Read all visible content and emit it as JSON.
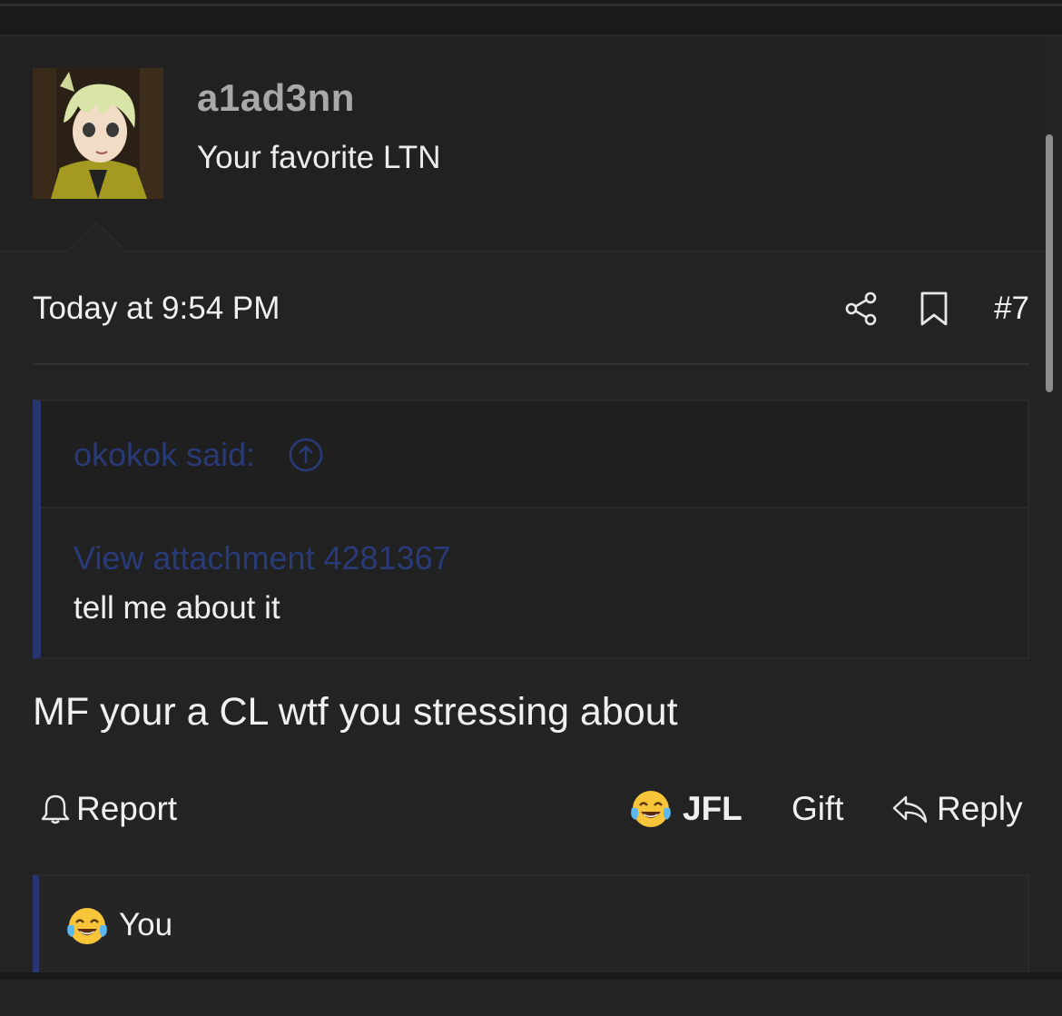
{
  "post": {
    "username": "a1ad3nn",
    "user_title": "Your favorite LTN",
    "timestamp": "Today at 9:54 PM",
    "post_number": "#7",
    "icons": {
      "share": "share-icon",
      "bookmark": "bookmark-icon",
      "quote_up": "arrow-up-circle-icon",
      "report": "bell-icon",
      "reply": "reply-arrow-icon",
      "reaction": "face-with-tears-of-joy-emoji"
    },
    "quote": {
      "author": "okokok said:",
      "attachment_link": "View attachment 4281367",
      "text": "tell me about it"
    },
    "message": "MF your a CL wtf you stressing about",
    "actions": {
      "report": "Report",
      "reaction": "JFL",
      "gift": "Gift",
      "reply": "Reply"
    },
    "reactions_summary": "You"
  },
  "colors": {
    "background": "#232323",
    "quote_accent": "#27366e",
    "link": "#283a78",
    "username": "#a8a8a8",
    "text": "#f0f0f0"
  }
}
